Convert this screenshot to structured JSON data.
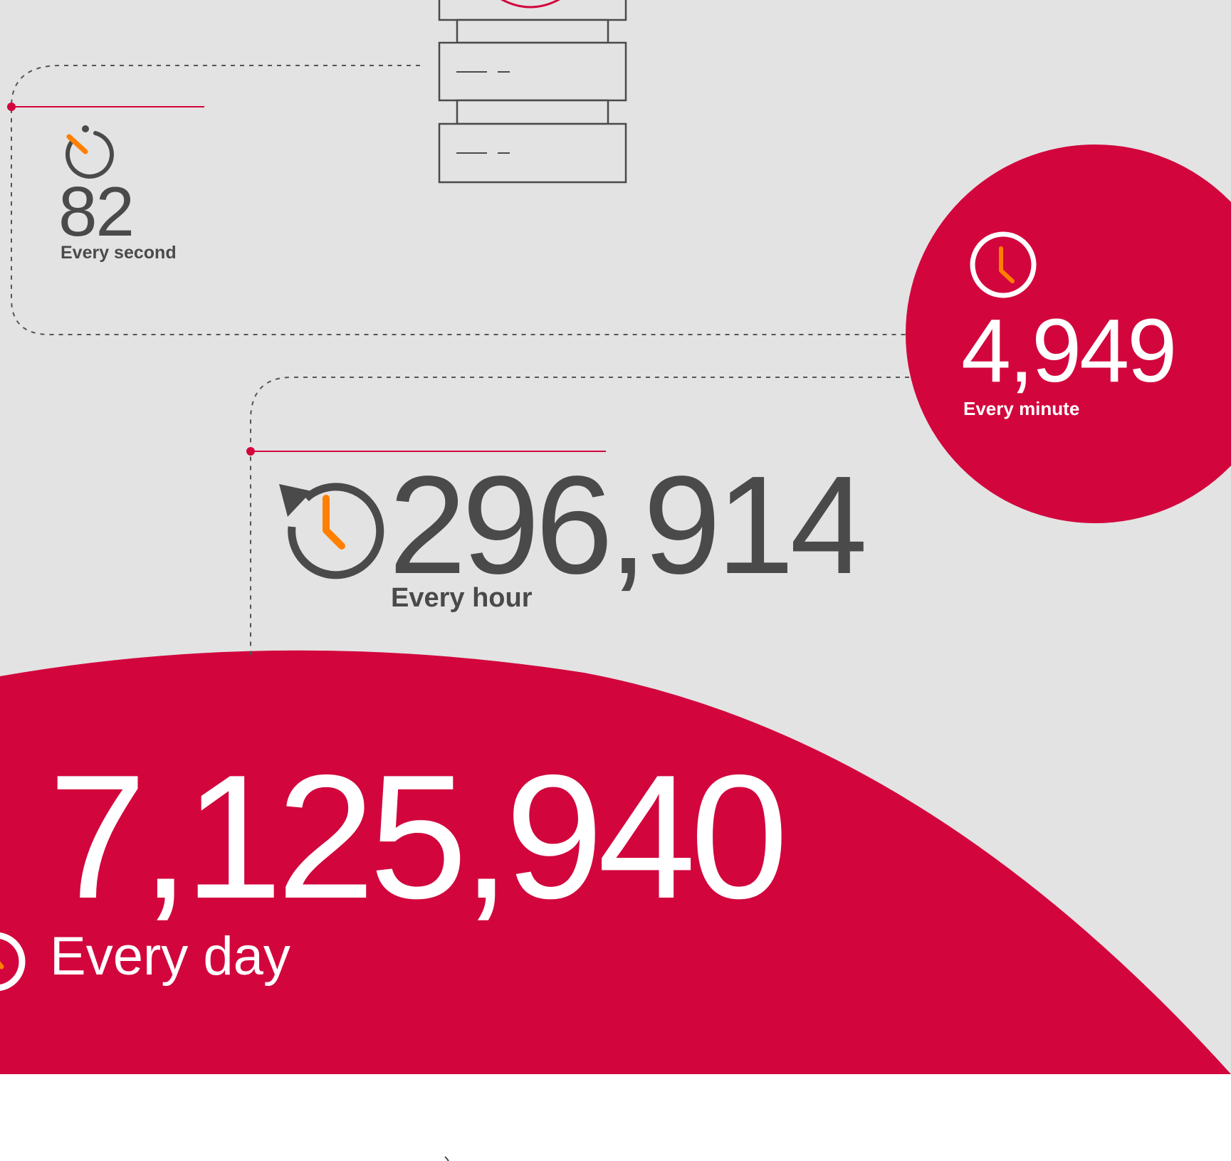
{
  "stats": [
    {
      "id": "second",
      "value": "82",
      "label": "Every second"
    },
    {
      "id": "minute",
      "value": "4,949",
      "label": "Every minute"
    },
    {
      "id": "hour",
      "value": "296,914",
      "label": "Every hour"
    },
    {
      "id": "day",
      "value": "7,125,940",
      "label": "Every day"
    }
  ],
  "icons": {
    "second": "stopwatch-icon",
    "minute": "clock-icon",
    "hour": "history-clock-icon",
    "day": "clock-icon",
    "server": "server-rack-icon"
  },
  "colors": {
    "background": "#e3e3e3",
    "accent": "#d2063d",
    "highlight": "#ff7f00",
    "text": "#4a4a4a",
    "inverse_text": "#ffffff"
  }
}
